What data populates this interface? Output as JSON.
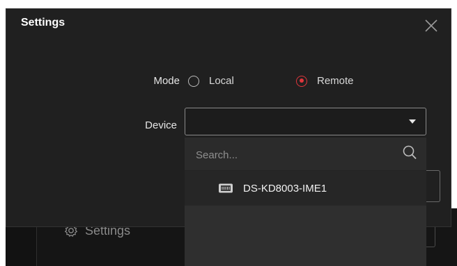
{
  "background": {
    "settings_label": "Settings"
  },
  "dialog": {
    "title": "Settings",
    "mode": {
      "label": "Mode",
      "options": [
        {
          "label": "Local",
          "selected": false
        },
        {
          "label": "Remote",
          "selected": true
        }
      ]
    },
    "device": {
      "label": "Device",
      "value": ""
    }
  },
  "dropdown": {
    "search_placeholder": "Search...",
    "items": [
      {
        "label": "DS-KD8003-IME1",
        "icon": "device-icon"
      }
    ]
  },
  "colors": {
    "accent": "#e0363c",
    "dialog_bg": "#202020",
    "dropdown_bg": "#2f2f2f"
  }
}
